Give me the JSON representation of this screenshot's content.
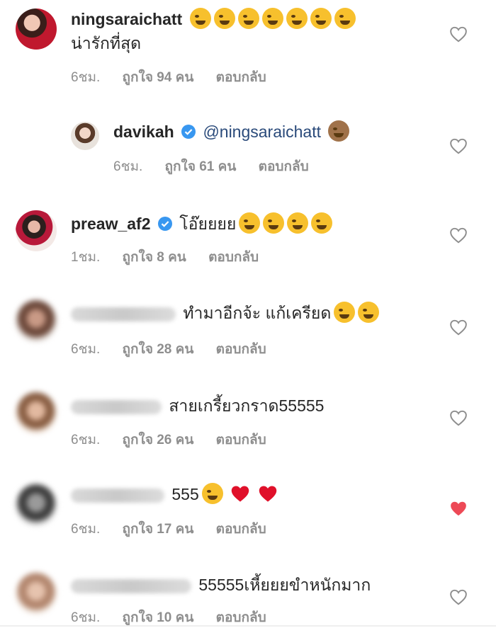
{
  "comments": [
    {
      "username": "ningsaraichatt",
      "text": "น่ารักที่สุด",
      "time": "6ชม.",
      "likes": "ถูกใจ 94 คน",
      "reply": "ตอบกลับ",
      "emojis": [
        "rofl-emoji",
        "rofl-emoji",
        "rofl-emoji",
        "rofl-emoji",
        "rofl-emoji",
        "rofl-emoji",
        "rofl-emoji"
      ],
      "liked": false
    },
    {
      "username": "davikah",
      "mention": "@ningsaraichatt",
      "time": "6ชม.",
      "likes": "ถูกใจ 61 คน",
      "reply": "ตอบกลับ",
      "emojis": [
        "see-no-evil-monkey-emoji"
      ],
      "verified": true,
      "liked": false
    },
    {
      "username": "preaw_af2",
      "text": "โอ๊ยยยย",
      "time": "1ชม.",
      "likes": "ถูกใจ 8 คน",
      "reply": "ตอบกลับ",
      "emojis": [
        "rofl-emoji",
        "rofl-emoji",
        "rofl-emoji",
        "rofl-emoji"
      ],
      "verified": true,
      "liked": false
    },
    {
      "text": "ทำมาอีกจ้ะ แก้เครียด",
      "time": "6ชม.",
      "likes": "ถูกใจ 28 คน",
      "reply": "ตอบกลับ",
      "emojis": [
        "joy-emoji",
        "joy-emoji"
      ],
      "liked": false
    },
    {
      "text": "สายเกรี้ยวกราด55555",
      "time": "6ชม.",
      "likes": "ถูกใจ 26 คน",
      "reply": "ตอบกลับ",
      "liked": false
    },
    {
      "text": "555",
      "time": "6ชม.",
      "likes": "ถูกใจ 17 คน",
      "reply": "ตอบกลับ",
      "emojis": [
        "sunglasses-emoji",
        "red-heart-emoji",
        "red-heart-emoji"
      ],
      "liked": true
    },
    {
      "text": "55555เหี้ยยยขำหนักมาก",
      "time": "6ชม.",
      "likes": "ถูกใจ 10 คน",
      "reply": "ตอบกลับ",
      "liked": false
    }
  ],
  "colors": {
    "heart_liked": "#ed4956",
    "heart_outline": "#8e8e8e",
    "verified": "#3897f0",
    "emoji_face": "#f7c02d"
  }
}
